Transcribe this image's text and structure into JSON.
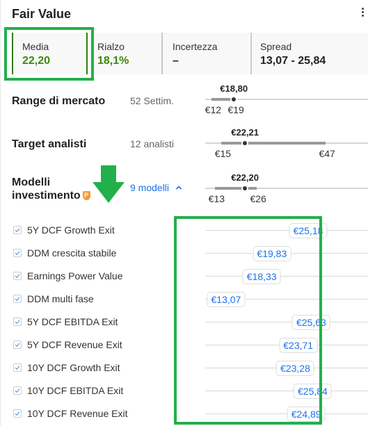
{
  "header": {
    "title": "Fair Value",
    "more_icon": "kebab-menu-icon"
  },
  "tiles": [
    {
      "label": "Media",
      "value": "22,20",
      "selected": true
    },
    {
      "label": "Rialzo",
      "value": "18,1%"
    },
    {
      "label": "Incertezza",
      "value": "–"
    },
    {
      "label": "Spread",
      "value": "13,07 - 25,84"
    }
  ],
  "sections": {
    "market_range": {
      "title": "Range di mercato",
      "subtitle": "52 Settim.",
      "current_label": "€18,80",
      "low_label": "€12",
      "high_label": "€19",
      "low": 12,
      "high": 19,
      "current": 18.8
    },
    "analyst_target": {
      "title": "Target analisti",
      "subtitle": "12 analisti",
      "current_label": "€22,21",
      "low_label": "€15",
      "high_label": "€47",
      "low": 15,
      "high": 47,
      "current": 22.21
    },
    "investment_models": {
      "title_line1": "Modelli",
      "title_line2": "investimento",
      "badge": "P",
      "badge_icon": "pro-badge-icon",
      "link_label": "9 modelli",
      "link_icon": "chevron-up-icon",
      "current_label": "€22,20",
      "low_label": "€13",
      "high_label": "€26",
      "low": 13.07,
      "high": 25.84,
      "current": 22.2
    }
  },
  "annotation": {
    "arrow_icon": "down-arrow-annotation-icon",
    "color": "#22b04b"
  },
  "models": [
    {
      "name": "5Y DCF Growth Exit",
      "value_label": "€25,18",
      "value": 25.18,
      "checked": true
    },
    {
      "name": "DDM crescita stabile",
      "value_label": "€19,83",
      "value": 19.83,
      "checked": true
    },
    {
      "name": "Earnings Power Value",
      "value_label": "€18,33",
      "value": 18.33,
      "checked": true
    },
    {
      "name": "DDM multi fase",
      "value_label": "€13,07",
      "value": 13.07,
      "checked": true
    },
    {
      "name": "5Y DCF EBITDA Exit",
      "value_label": "€25,63",
      "value": 25.63,
      "checked": true
    },
    {
      "name": "5Y DCF Revenue Exit",
      "value_label": "€23,71",
      "value": 23.71,
      "checked": true
    },
    {
      "name": "10Y DCF Growth Exit",
      "value_label": "€23,28",
      "value": 23.28,
      "checked": true
    },
    {
      "name": "10Y DCF EBITDA Exit",
      "value_label": "€25,84",
      "value": 25.84,
      "checked": true
    },
    {
      "name": "10Y DCF Revenue Exit",
      "value_label": "€24,89",
      "value": 24.89,
      "checked": true
    }
  ],
  "colors": {
    "accent_green": "#3b8a0b",
    "link_blue": "#1a73e8",
    "highlight_green": "#22b04b"
  }
}
